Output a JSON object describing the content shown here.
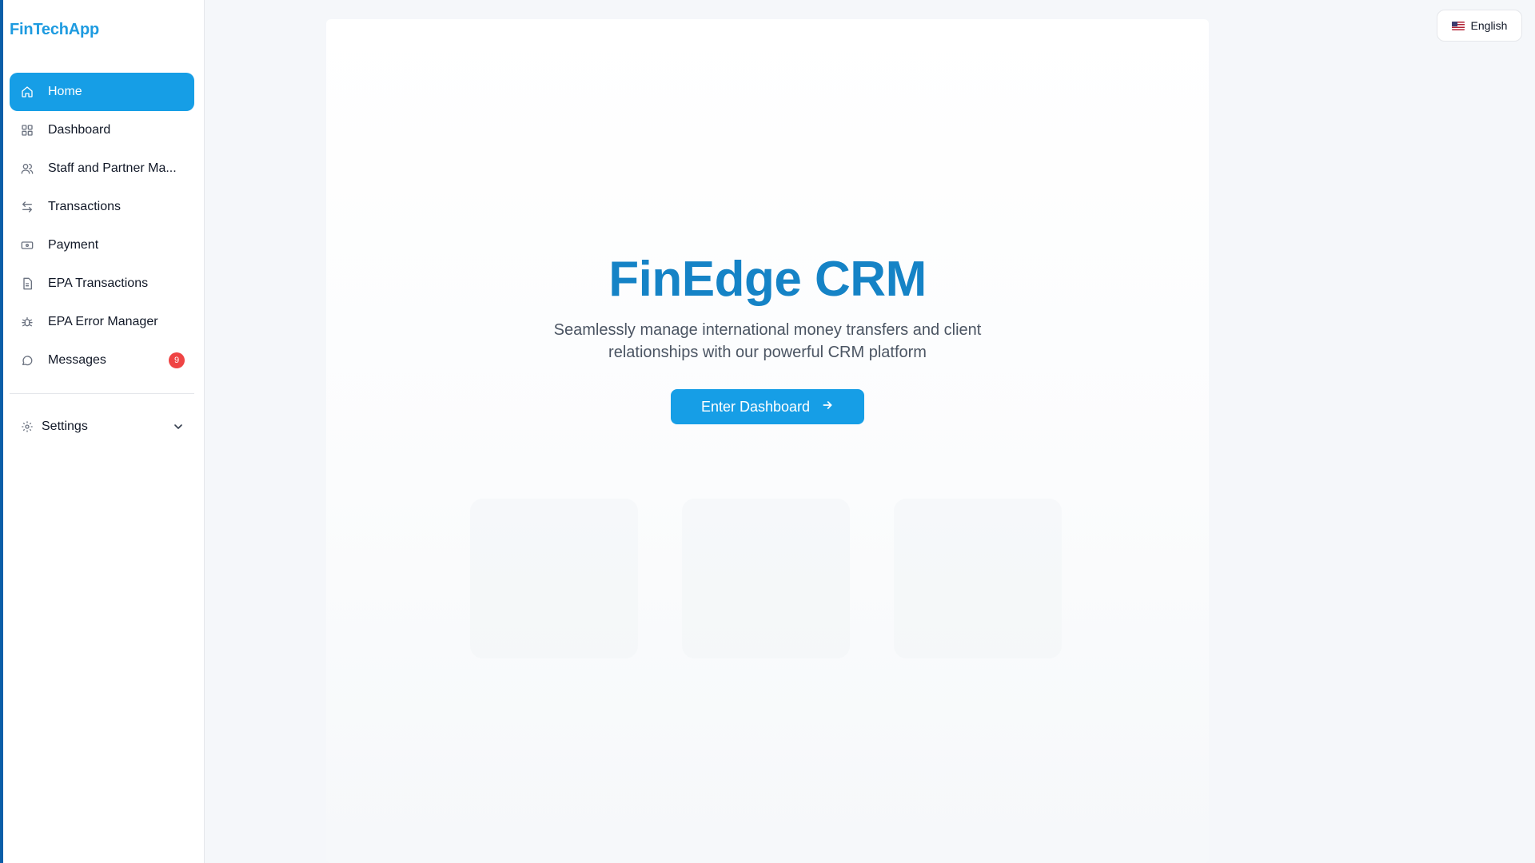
{
  "app": {
    "brand": "FinTechApp"
  },
  "sidebar": {
    "items": [
      {
        "label": "Home",
        "icon": "home-icon",
        "active": true
      },
      {
        "label": "Dashboard",
        "icon": "grid-icon",
        "active": false
      },
      {
        "label": "Staff and Partner Ma...",
        "icon": "users-icon",
        "active": false
      },
      {
        "label": "Transactions",
        "icon": "arrows-exchange-icon",
        "active": false
      },
      {
        "label": "Payment",
        "icon": "banknote-icon",
        "active": false
      },
      {
        "label": "EPA Transactions",
        "icon": "document-icon",
        "active": false
      },
      {
        "label": "EPA Error Manager",
        "icon": "bug-icon",
        "active": false
      },
      {
        "label": "Messages",
        "icon": "message-icon",
        "active": false,
        "badge": "9"
      }
    ],
    "settings": {
      "label": "Settings",
      "icon": "gear-icon"
    }
  },
  "header": {
    "language": "English",
    "language_icon": "us-flag-icon"
  },
  "hero": {
    "title": "FinEdge CRM",
    "subtitle": "Seamlessly manage international money transfers and client relationships with our powerful CRM platform",
    "cta_label": "Enter Dashboard",
    "cta_icon": "arrow-right-icon"
  },
  "colors": {
    "accent": "#169ee6",
    "brand": "#1e9be0",
    "title": "#1583c6",
    "badge": "#ef4444",
    "left_accent": "#0b5ea8"
  }
}
